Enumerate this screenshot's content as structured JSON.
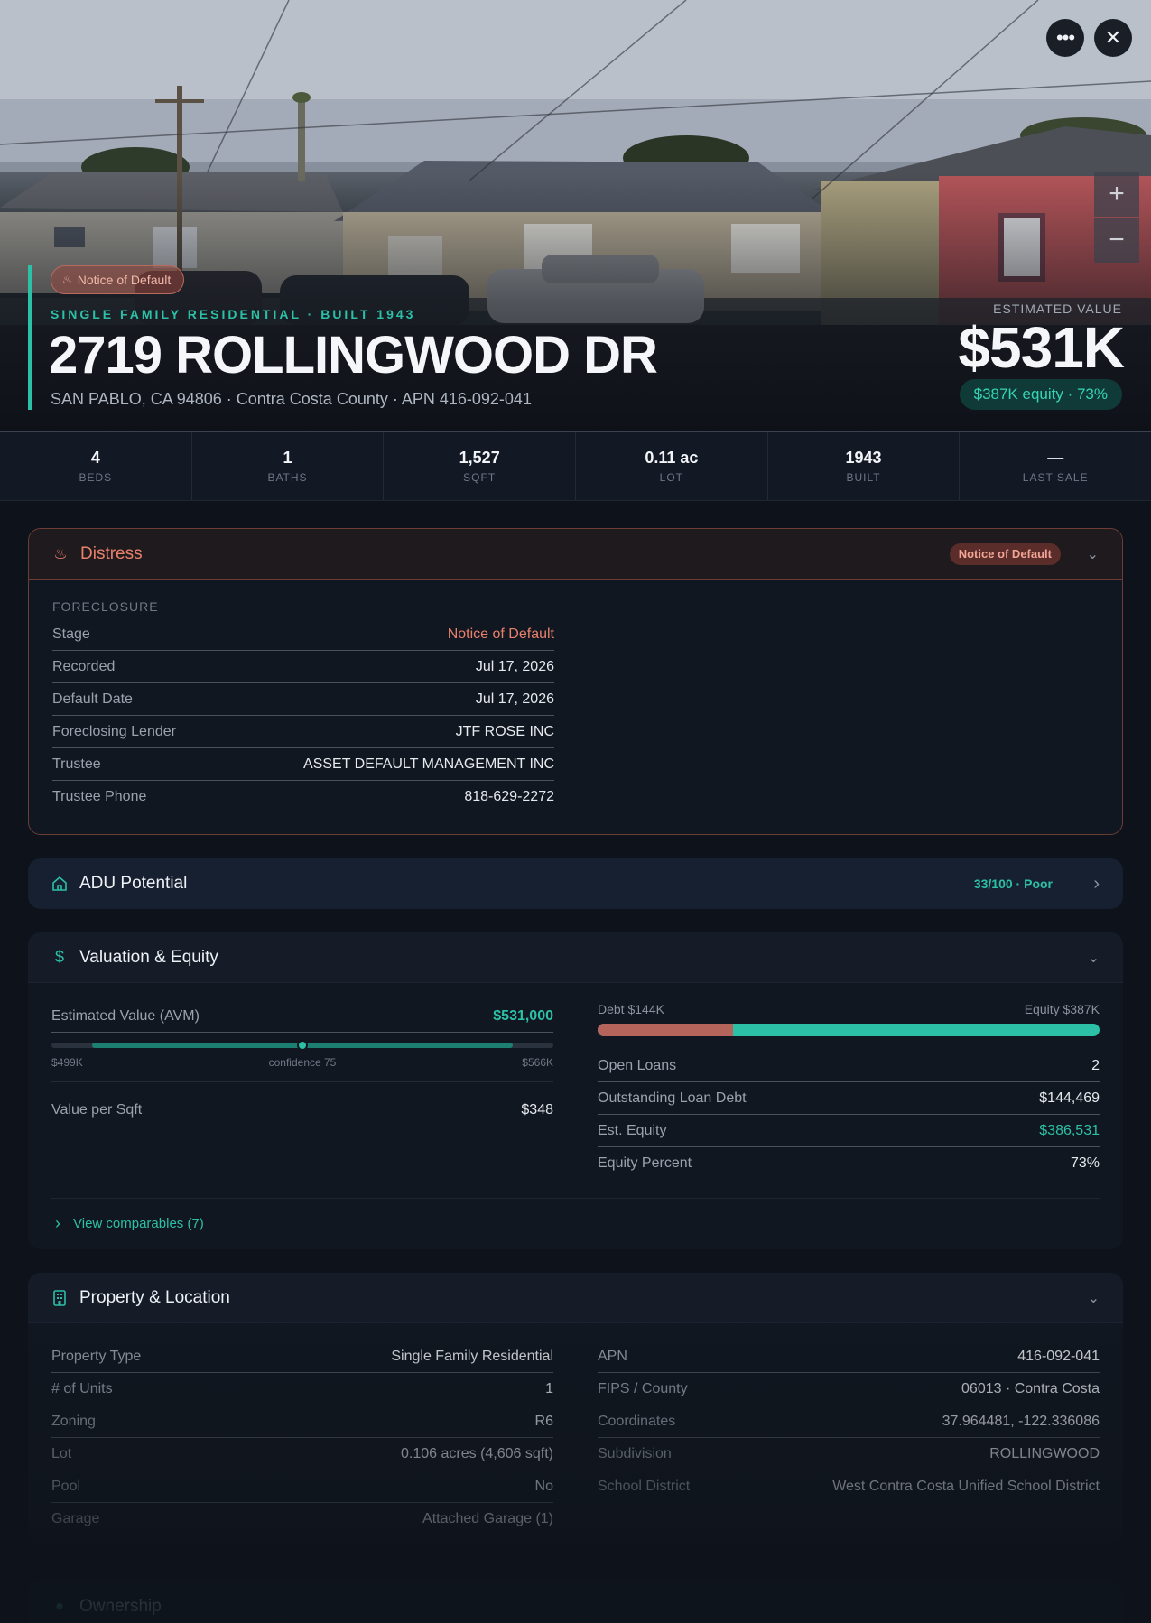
{
  "hero": {
    "badge": "Notice of Default",
    "subtitle": "SINGLE FAMILY RESIDENTIAL · BUILT 1943",
    "title": "2719 ROLLINGWOOD DR",
    "address": "SAN PABLO, CA 94806 · Contra Costa County · APN 416-092-041",
    "estimated_label": "ESTIMATED VALUE",
    "estimated_value": "$531K",
    "equity_pill": "$387K equity · 73%",
    "more_icon": "ellipsis-icon",
    "close_icon": "close-icon",
    "zoom_in": "+",
    "zoom_out": "−"
  },
  "stats": [
    {
      "value": "4",
      "label": "BEDS"
    },
    {
      "value": "1",
      "label": "BATHS"
    },
    {
      "value": "1,527",
      "label": "SQFT"
    },
    {
      "value": "0.11 ac",
      "label": "LOT"
    },
    {
      "value": "1943",
      "label": "BUILT"
    },
    {
      "value": "—",
      "label": "LAST SALE"
    }
  ],
  "distress": {
    "title": "Distress",
    "badge": "Notice of Default",
    "section": "FORECLOSURE",
    "rows": [
      {
        "k": "Stage",
        "v": "Notice of Default"
      },
      {
        "k": "Recorded",
        "v": "Jul 17, 2026"
      },
      {
        "k": "Default Date",
        "v": "Jul 17, 2026"
      },
      {
        "k": "Foreclosing Lender",
        "v": "JTF ROSE INC"
      },
      {
        "k": "Trustee",
        "v": "ASSET DEFAULT MANAGEMENT INC"
      },
      {
        "k": "Trustee Phone",
        "v": "818-629-2272"
      }
    ]
  },
  "adu": {
    "title": "ADU Potential",
    "score": "33/100 · Poor"
  },
  "valuation": {
    "title": "Valuation & Equity",
    "avm_label": "Estimated Value (AVM)",
    "avm_value": "$531,000",
    "range_low": "$499K",
    "range_high": "$566K",
    "confidence": "confidence 75",
    "confidence_position": 0.5,
    "value_per_sqft_label": "Value per Sqft",
    "value_per_sqft": "$348",
    "debt_label": "Debt $144K",
    "equity_label": "Equity $387K",
    "debt_fraction": 0.27,
    "rows": [
      {
        "k": "Open Loans",
        "v": "2"
      },
      {
        "k": "Outstanding Loan Debt",
        "v": "$144,469"
      },
      {
        "k": "Est. Equity",
        "v": "$386,531"
      },
      {
        "k": "Equity Percent",
        "v": "73%"
      }
    ],
    "comparables": "View comparables (7)"
  },
  "property": {
    "title": "Property & Location",
    "left_rows": [
      {
        "k": "Property Type",
        "v": "Single Family Residential"
      },
      {
        "k": "# of Units",
        "v": "1"
      },
      {
        "k": "Zoning",
        "v": "R6"
      },
      {
        "k": "Lot",
        "v": "0.106 acres (4,606 sqft)"
      },
      {
        "k": "Pool",
        "v": "No"
      },
      {
        "k": "Garage",
        "v": "Attached Garage (1)"
      }
    ],
    "right_rows": [
      {
        "k": "APN",
        "v": "416-092-041"
      },
      {
        "k": "FIPS / County",
        "v": "06013 · Contra Costa"
      },
      {
        "k": "Coordinates",
        "v": "37.964481, -122.336086"
      },
      {
        "k": "Subdivision",
        "v": "ROLLINGWOOD"
      },
      {
        "k": "School District",
        "v": "West Contra Costa Unified School District"
      }
    ]
  },
  "ownership": {
    "title": "Ownership"
  },
  "colors": {
    "accent": "#2cc0a6",
    "distress": "#e8806c",
    "debt": "#b4645a"
  }
}
